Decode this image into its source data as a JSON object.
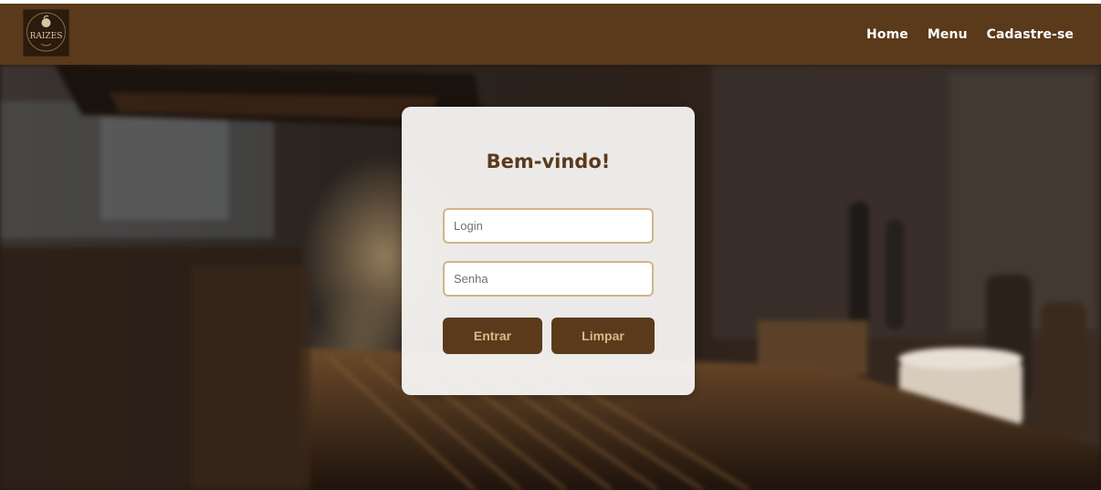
{
  "header": {
    "logo_text": "RAIZES",
    "nav": [
      {
        "label": "Home"
      },
      {
        "label": "Menu"
      },
      {
        "label": "Cadastre-se"
      }
    ]
  },
  "login": {
    "title": "Bem-vindo!",
    "login_placeholder": "Login",
    "login_value": "",
    "password_placeholder": "Senha",
    "password_value": "",
    "submit_label": "Entrar",
    "clear_label": "Limpar"
  },
  "colors": {
    "brand_brown": "#5a3a1b",
    "button_text": "#d8b98a",
    "input_border": "#d1b48a"
  }
}
